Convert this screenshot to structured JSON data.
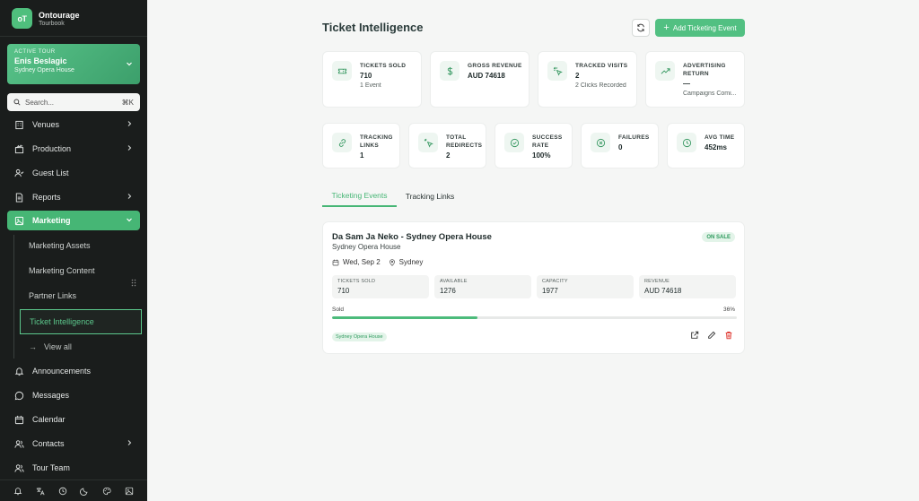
{
  "brand": {
    "name": "Ontourage",
    "sub": "Tourbook",
    "logo_text": "oT"
  },
  "active_tour": {
    "label": "ACTIVE TOUR",
    "name": "Enis Beslagic",
    "venue": "Sydney Opera House"
  },
  "search": {
    "placeholder": "Search...",
    "shortcut": "⌘K"
  },
  "nav": {
    "venues": "Venues",
    "production": "Production",
    "guest_list": "Guest List",
    "reports": "Reports",
    "marketing": "Marketing",
    "announcements": "Announcements",
    "messages": "Messages",
    "calendar": "Calendar",
    "contacts": "Contacts",
    "tour_team": "Tour Team"
  },
  "marketing_sub": {
    "assets": "Marketing Assets",
    "content": "Marketing Content",
    "partner_links": "Partner Links",
    "ticket_intelligence": "Ticket Intelligence",
    "view_all": "View all"
  },
  "page": {
    "title": "Ticket Intelligence",
    "add_button": "Add Ticketing Event"
  },
  "stats_top": [
    {
      "label": "TICKETS SOLD",
      "value": "710",
      "sub": "1 Event",
      "icon": "ticket-icon"
    },
    {
      "label": "GROSS REVENUE",
      "value": "AUD 74618",
      "sub": "",
      "icon": "dollar-icon"
    },
    {
      "label": "TRACKED VISITS",
      "value": "2",
      "sub": "2 Clicks Recorded",
      "icon": "click-icon"
    },
    {
      "label": "ADVERTISING RETURN",
      "value": "—",
      "sub": "Campaigns Comi...",
      "icon": "trend-up-icon"
    }
  ],
  "stats_bottom": [
    {
      "label": "TRACKING LINKS",
      "value": "1",
      "icon": "link-icon"
    },
    {
      "label": "TOTAL REDIRECTS",
      "value": "2",
      "icon": "redirect-icon"
    },
    {
      "label": "SUCCESS RATE",
      "value": "100%",
      "icon": "check-circle-icon"
    },
    {
      "label": "FAILURES",
      "value": "0",
      "icon": "x-circle-icon"
    },
    {
      "label": "AVG TIME",
      "value": "452ms",
      "icon": "clock-icon"
    }
  ],
  "tabs": {
    "events": "Ticketing Events",
    "links": "Tracking Links"
  },
  "event": {
    "title": "Da Sam Ja Neko - Sydney Opera House",
    "venue": "Sydney Opera House",
    "status": "ON SALE",
    "date": "Wed, Sep 2",
    "city": "Sydney",
    "stats": [
      {
        "label": "TICKETS SOLD",
        "value": "710"
      },
      {
        "label": "AVAILABLE",
        "value": "1276"
      },
      {
        "label": "CAPACITY",
        "value": "1977"
      },
      {
        "label": "REVENUE",
        "value": "AUD 74618"
      }
    ],
    "sold_label": "Sold",
    "sold_pct_text": "36%",
    "sold_fraction": 0.36,
    "venue_tag": "Sydney Opera House"
  },
  "colors": {
    "accent": "#46b675",
    "sidebar_bg": "#1a1d1c",
    "danger": "#e0413a"
  }
}
